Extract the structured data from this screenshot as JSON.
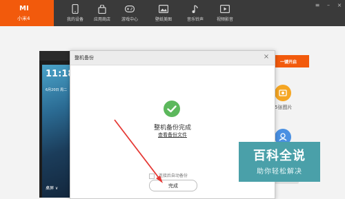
{
  "app": {
    "logo_text": "MI",
    "model": "小米4"
  },
  "nav": [
    {
      "label": "我的设备",
      "icon": "phone-icon"
    },
    {
      "label": "应用商店",
      "icon": "bag-icon"
    },
    {
      "label": "游戏中心",
      "icon": "gamepad-icon"
    },
    {
      "label": "壁纸美图",
      "icon": "picture-icon"
    },
    {
      "label": "音乐铃声",
      "icon": "music-icon"
    },
    {
      "label": "视频影音",
      "icon": "video-icon"
    }
  ],
  "window_controls": [
    "≡",
    "–",
    "×"
  ],
  "phone": {
    "time": "11:18",
    "date": "6月20日 周二",
    "desktop_label": "桌屏 ∨"
  },
  "right_panel": {
    "one_key_button": "一键开启",
    "photo_count": "5张图片"
  },
  "modal": {
    "title": "整机备份",
    "close": "×",
    "status_title": "整机备份完成",
    "view_link": "查看备份文件",
    "auto_backup_label": "连接后自动备份",
    "finish_button": "完成"
  },
  "watermark": {
    "main": "百科全说",
    "sub": "助你轻松解决"
  },
  "colors": {
    "accent": "#f25a0c",
    "success": "#5cb85c",
    "arrow": "#e53935",
    "watermark": "#4aa0a9"
  }
}
